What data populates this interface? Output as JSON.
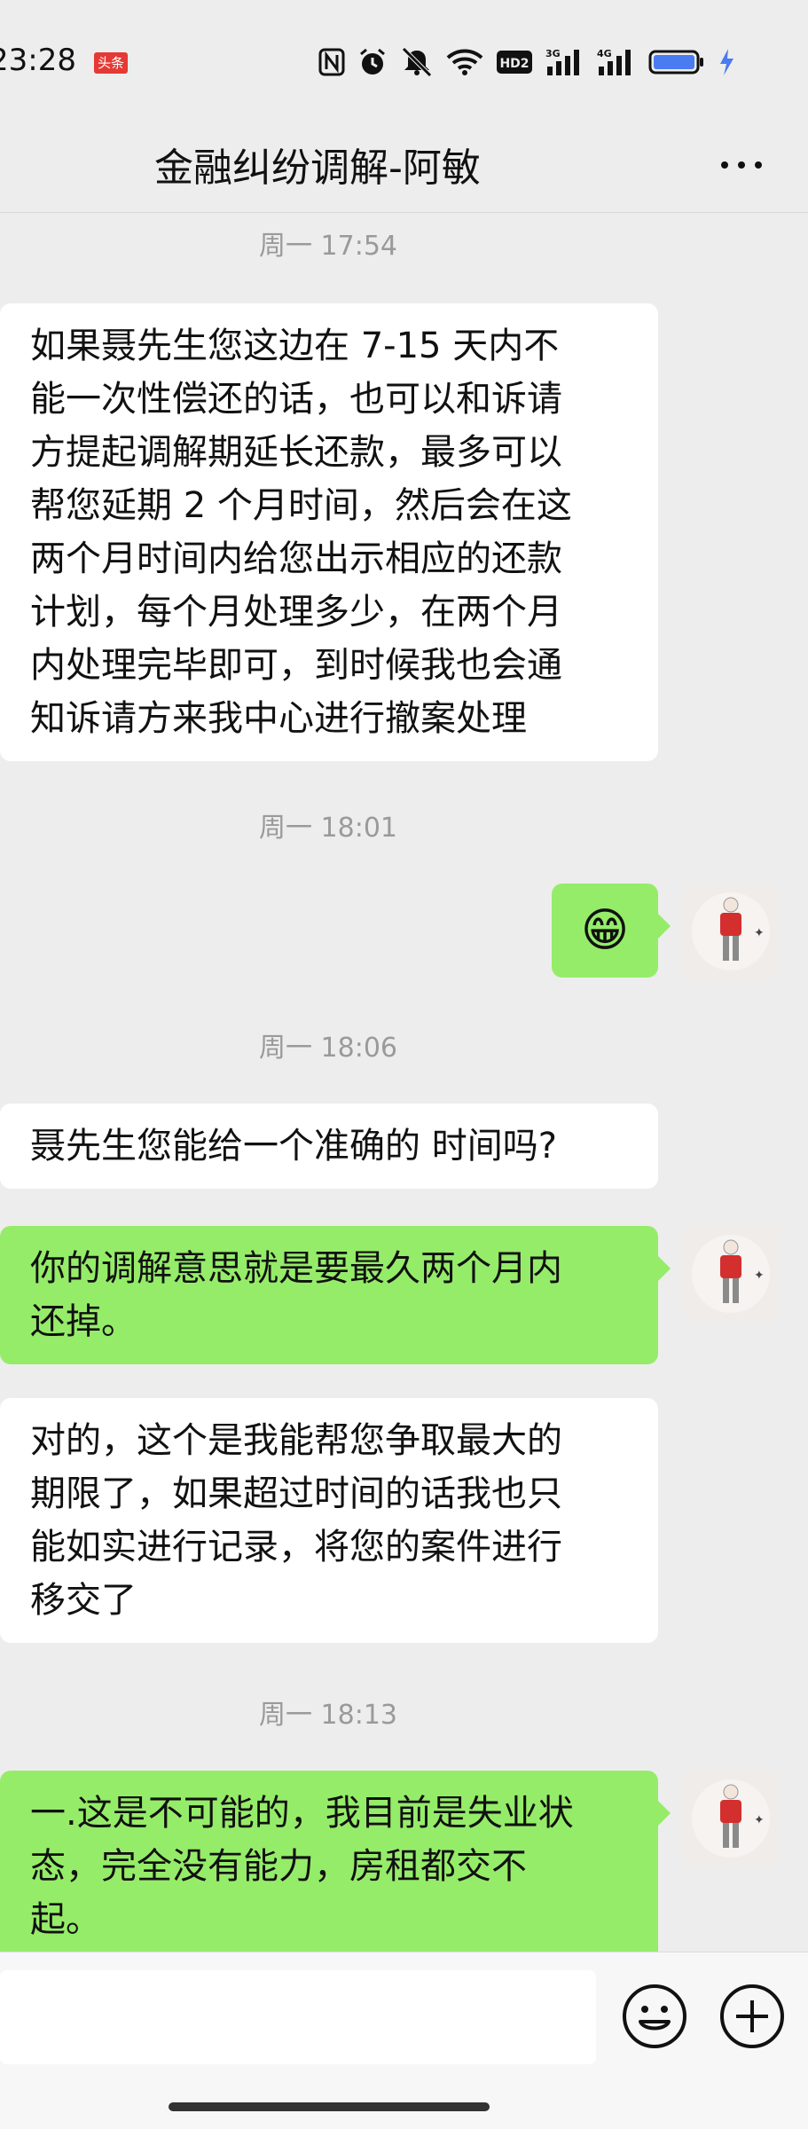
{
  "status_bar": {
    "time": "23:28",
    "badge": "头条",
    "hd_label": "HD2",
    "signal1_label": "3G",
    "signal2_label": "4G",
    "battery_color": "#4a7bf0",
    "icons": [
      "nfc-icon",
      "alarm-icon",
      "mute-icon",
      "wifi-icon",
      "hd-icon",
      "signal-icon",
      "signal-icon",
      "battery-icon",
      "charging-icon"
    ]
  },
  "header": {
    "title": "金融纠纷调解-阿敏",
    "more_icon": "more-icon"
  },
  "messages": [
    {
      "type": "time",
      "text": "周一 17:54"
    },
    {
      "type": "incoming",
      "lines": [
        "如果聂先生您这边在 7-15 天内不",
        "能一次性偿还的话，也可以和诉请",
        "方提起调解期延长还款，最多可以",
        "帮您延期 2 个月时间，然后会在这",
        "两个月时间内给您出示相应的还款",
        "计划，每个月处理多少，在两个月",
        "内处理完毕即可，到时候我也会通",
        "知诉请方来我中心进行撤案处理"
      ]
    },
    {
      "type": "time",
      "text": "周一 18:01"
    },
    {
      "type": "outgoing",
      "emoji": "😁"
    },
    {
      "type": "time",
      "text": "周一 18:06"
    },
    {
      "type": "incoming",
      "lines": [
        "聂先生您能给一个准确的 时间吗?"
      ]
    },
    {
      "type": "outgoing",
      "lines": [
        "你的调解意思就是要最久两个月内",
        "还掉。"
      ]
    },
    {
      "type": "incoming",
      "lines": [
        "对的，这个是我能帮您争取最大的",
        "期限了，如果超过时间的话我也只",
        "能如实进行记录，将您的案件进行",
        "移交了"
      ]
    },
    {
      "type": "time",
      "text": "周一 18:13"
    },
    {
      "type": "outgoing",
      "lines": [
        "一.这是不可能的，我目前是失业状",
        "态，完全没有能力，房租都交不",
        "起。"
      ]
    }
  ],
  "colors": {
    "background": "#ededed",
    "incoming_bubble": "#ffffff",
    "outgoing_bubble": "#95ec69",
    "timestamp": "#9a9a9a",
    "avatar_shirt": "#d32f2f"
  },
  "input_bar": {
    "value": "",
    "emoji_button_icon": "emoji-icon",
    "plus_button_icon": "plus-icon"
  }
}
